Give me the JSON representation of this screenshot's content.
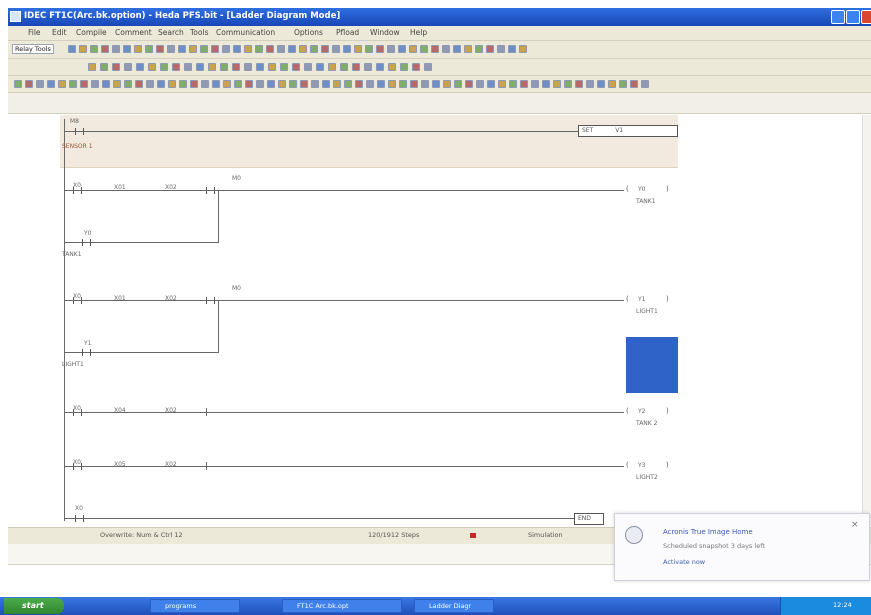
{
  "window": {
    "title": "IDEC FT1C(Arc.bk.option) - Heda PFS.bit - [Ladder Diagram Mode]"
  },
  "menu": [
    "File",
    "Edit",
    "Compile",
    "Comment",
    "Search",
    "Tools",
    "Communication",
    "Options",
    "Pfload",
    "Window",
    "Help"
  ],
  "toolbar": {
    "mode_combo": "Relay Tools"
  },
  "ladder": {
    "header": {
      "contact_label": "M8",
      "rung_comment": "SENSOR 1",
      "box_label": "SET",
      "box_value": "V1"
    },
    "rungs": [
      {
        "contacts": [
          "X0",
          "X01",
          "X02"
        ],
        "nc_label": "M0",
        "coil_label": "Y0",
        "coil_comment": "TANK1",
        "branch_label": "Y0",
        "branch_comment": "TANK1"
      },
      {
        "contacts": [
          "X0",
          "X01",
          "X02"
        ],
        "nc_label": "M0",
        "coil_label": "Y1",
        "coil_comment": "LIGHT1",
        "branch_label": "Y1",
        "branch_comment": "LIGHT1"
      },
      {
        "contacts": [
          "X0",
          "X04",
          "X02"
        ],
        "coil_label": "Y2",
        "coil_comment": "TANK 2"
      },
      {
        "contacts": [
          "X0",
          "X05",
          "X02"
        ],
        "coil_label": "Y3",
        "coil_comment": "LIGHT2"
      }
    ],
    "last_rung": {
      "contact_label": "X0",
      "box_label": "END"
    },
    "highlight_color": "#2f63c8"
  },
  "statusbar": {
    "mode": "Overwrite: Num & Ctrl 12",
    "steps": "120/1912 Steps",
    "simulation": "Simulation"
  },
  "notification": {
    "line1": "Acronis True Image Home",
    "line2": "Scheduled snapshot 3 days left",
    "link": "Activate now"
  },
  "taskbar": {
    "start_label": "start",
    "tasks": [
      "programs",
      "FT1C Arc.bk.opt",
      "Ladder Diagr"
    ],
    "clock": "12:24"
  }
}
